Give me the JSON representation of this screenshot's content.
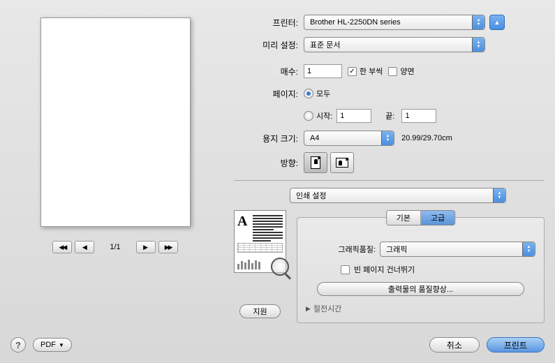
{
  "labels": {
    "printer": "프린터:",
    "preset": "미리 설정:",
    "copies": "매수:",
    "pages": "페이지:",
    "paper_size": "용지 크기:",
    "orientation": "방향:"
  },
  "printer": {
    "selected": "Brother HL-2250DN series"
  },
  "preset": {
    "selected": "표준 문서"
  },
  "copies": {
    "value": "1",
    "collate_label": "한 부씩",
    "duplex_label": "양면"
  },
  "pages": {
    "all_label": "모두",
    "from_label": "시작:",
    "from_value": "1",
    "to_label": "끝:",
    "to_value": "1"
  },
  "paper_size": {
    "selected": "A4",
    "dimensions": "20.99/29.70cm"
  },
  "section": {
    "selected": "인쇄 설정"
  },
  "tabs": {
    "basic": "기본",
    "advanced": "고급"
  },
  "advanced_panel": {
    "graphic_quality_label": "그래픽품질:",
    "graphic_quality_value": "그래픽",
    "skip_blank_label": "빈 페이지 건너뛰기",
    "output_quality_btn": "출력물의 품질향상...",
    "sleep_time_label": "절전시간"
  },
  "preview": {
    "page_counter": "1/1"
  },
  "buttons": {
    "support": "지원",
    "pdf": "PDF",
    "cancel": "취소",
    "print": "프린트"
  }
}
